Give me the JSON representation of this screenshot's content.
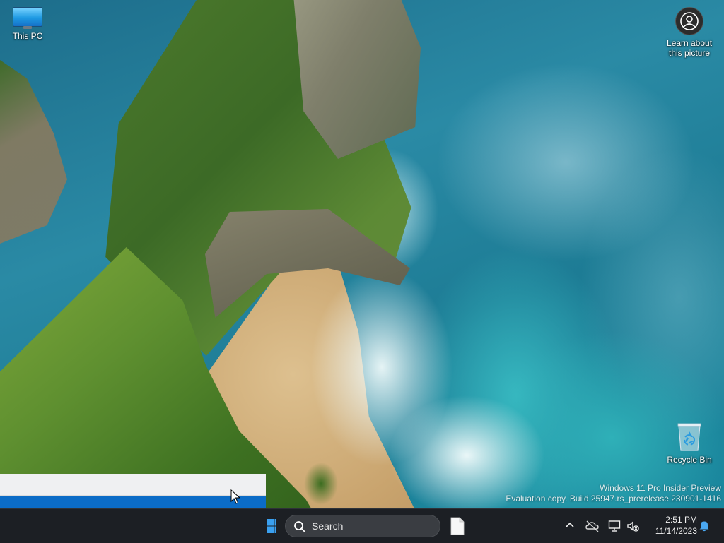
{
  "desktop": {
    "icons": [
      {
        "label": "This PC",
        "icon": "this-pc-icon"
      },
      {
        "label": "Learn about\nthis picture",
        "icon": "learn-about-picture-icon"
      },
      {
        "label": "Recycle Bin",
        "icon": "recycle-bin-icon"
      }
    ],
    "watermark": {
      "line1": "Windows 11 Pro Insider Preview",
      "line2": "Evaluation copy. Build 25947.rs_prerelease.230901-1416"
    }
  },
  "taskbar": {
    "search_label": "Search",
    "pinned": [
      {
        "icon": "notepad-icon"
      }
    ],
    "tray": {
      "icons": [
        "chevron-up-icon",
        "onedrive-offline-icon",
        "network-icon",
        "volume-muted-icon",
        "notification-bell-icon"
      ],
      "time": "2:51 PM",
      "date": "11/14/2023"
    },
    "colors": {
      "background": "#1c1f24",
      "accent": "#0b6cc7"
    }
  }
}
